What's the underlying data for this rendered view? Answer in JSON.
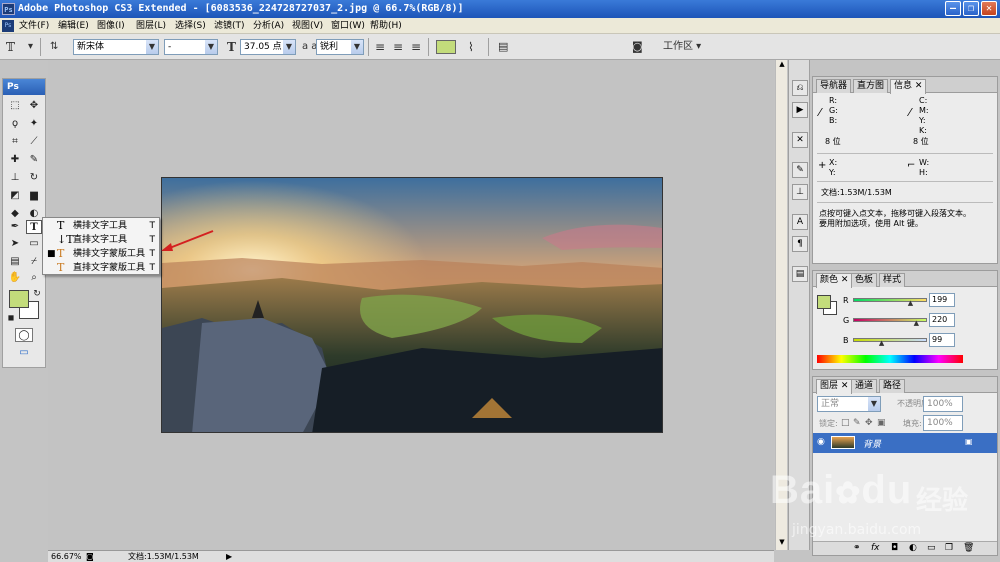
{
  "window": {
    "title": "Adobe Photoshop CS3 Extended - [6083536_224728727037_2.jpg @ 66.7%(RGB/8)]",
    "logo_text": "Ps",
    "buttons": {
      "minimize": "–",
      "restore": "❐",
      "close": "✕"
    }
  },
  "menu": {
    "items": [
      "文件(F)",
      "编辑(E)",
      "图像(I)",
      "图层(L)",
      "选择(S)",
      "滤镜(T)",
      "分析(A)",
      "视图(V)",
      "窗口(W)",
      "帮助(H)"
    ]
  },
  "options": {
    "font_family": "新宋体",
    "font_style": "-",
    "font_size": "37.05 点",
    "aa_label": "a a",
    "antialias": "锐利",
    "color_swatch": "#c3dc7b",
    "workspace": "工作区"
  },
  "toolbox": {
    "header": "Ps",
    "fg_color": "#c3dc7b",
    "bg_color": "#ffffff"
  },
  "flyout": {
    "items": [
      {
        "label": "横排文字工具",
        "key": "T",
        "selected": false
      },
      {
        "label": "直排文字工具",
        "key": "T",
        "selected": false
      },
      {
        "label": "横排文字蒙版工具",
        "key": "T",
        "selected": true
      },
      {
        "label": "直排文字蒙版工具",
        "key": "T",
        "selected": false
      }
    ]
  },
  "info_panel": {
    "tabs": [
      "导航器",
      "直方图",
      "信息"
    ],
    "active_tab": "信息",
    "rgb": {
      "r": "R:",
      "g": "G:",
      "b": "B:",
      "bits": "8 位"
    },
    "cmyk": {
      "c": "C:",
      "m": "M:",
      "y": "Y:",
      "k": "K:",
      "bits": "8 位"
    },
    "xy": {
      "x": "X:",
      "y": "Y:"
    },
    "wh": {
      "w": "W:",
      "h": "H:"
    },
    "doc": "文档:1.53M/1.53M",
    "hint_line1": "点按可键入点文本，拖移可键入段落文本。",
    "hint_line2": "要用附加选项，使用 Alt 键。"
  },
  "color_panel": {
    "tabs": [
      "颜色",
      "色板",
      "样式"
    ],
    "active_tab": "颜色",
    "r_label": "R",
    "g_label": "G",
    "b_label": "B",
    "r": "199",
    "g": "220",
    "b": "99",
    "r_level": 0.78,
    "g_level": 0.86,
    "b_level": 0.39
  },
  "layers_panel": {
    "tabs": [
      "图层",
      "通道",
      "路径"
    ],
    "active_tab": "图层",
    "blend_mode": "正常",
    "opacity_label": "不透明度:",
    "opacity": "100%",
    "lock_label": "锁定:",
    "fill_label": "填充:",
    "fill": "100%",
    "layers": [
      {
        "name": "背景",
        "visible": true,
        "locked": true
      }
    ]
  },
  "status": {
    "zoom": "66.67%",
    "doc": "文档:1.53M/1.53M"
  },
  "watermark": {
    "brand": "Bai",
    "brand2": "du",
    "cn": "经验",
    "url": "jingyan.baidu.com"
  }
}
